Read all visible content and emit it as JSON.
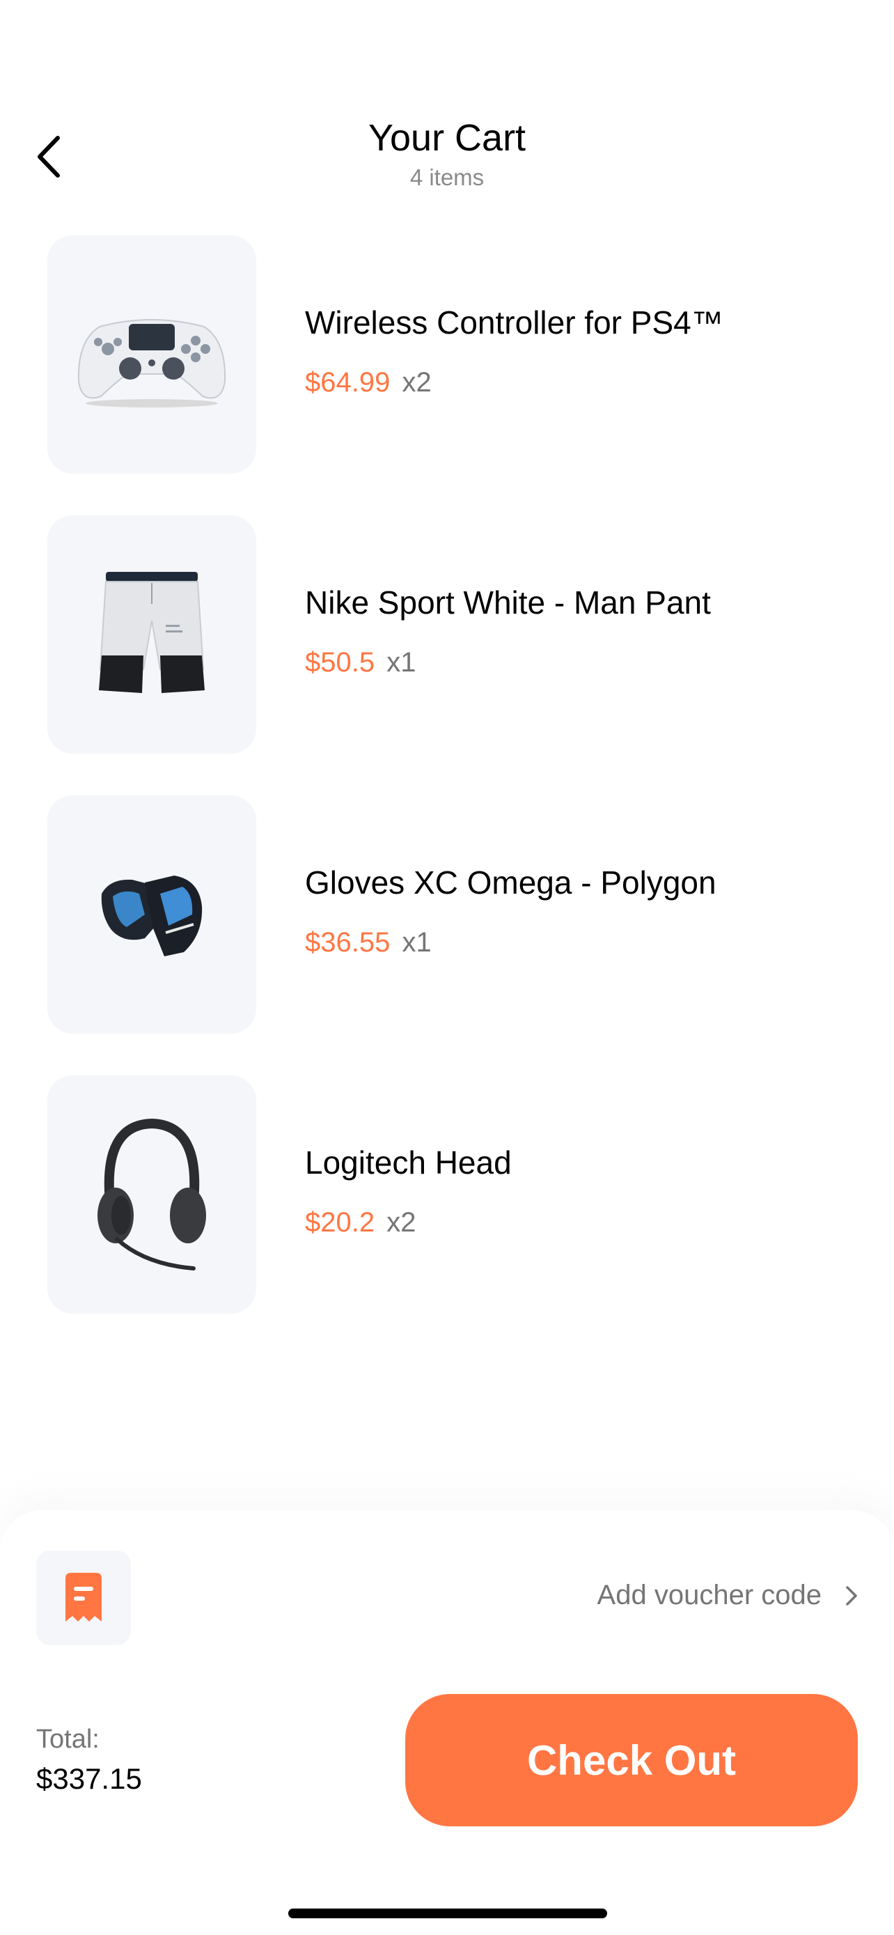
{
  "header": {
    "title": "Your Cart",
    "subtitle": "4 items"
  },
  "items": [
    {
      "name": "Wireless Controller for PS4™",
      "price": "$64.99",
      "qty": "x2",
      "icon": "game-controller-icon"
    },
    {
      "name": "Nike Sport White - Man Pant",
      "price": "$50.5",
      "qty": "x1",
      "icon": "shorts-icon"
    },
    {
      "name": "Gloves XC Omega - Polygon",
      "price": "$36.55",
      "qty": "x1",
      "icon": "gloves-icon"
    },
    {
      "name": "Logitech Head",
      "price": "$20.2",
      "qty": "x2",
      "icon": "headset-icon"
    }
  ],
  "voucher": {
    "label": "Add voucher code",
    "icon": "receipt-icon"
  },
  "total": {
    "label": "Total:",
    "value": "$337.15"
  },
  "checkout": {
    "label": "Check Out"
  },
  "colors": {
    "accent": "#ff7643",
    "thumb_bg": "#f5f6f9",
    "muted_text": "#757575"
  }
}
